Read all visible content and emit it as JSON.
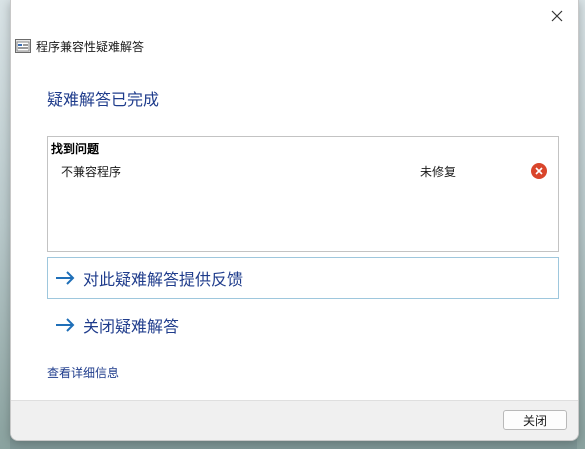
{
  "window": {
    "title": "程序兼容性疑难解答"
  },
  "heading": "疑难解答已完成",
  "results": {
    "header": "找到问题",
    "rows": [
      {
        "name": "不兼容程序",
        "status": "未修复",
        "status_icon": "error-icon"
      }
    ]
  },
  "links": {
    "feedback": "对此疑难解答提供反馈",
    "close_troubleshooter": "关闭疑难解答",
    "details": "查看详细信息"
  },
  "footer": {
    "close_label": "关闭"
  },
  "colors": {
    "link": "#1f3c8c",
    "error": "#d9452b",
    "focus_border": "#9ec7dd"
  }
}
